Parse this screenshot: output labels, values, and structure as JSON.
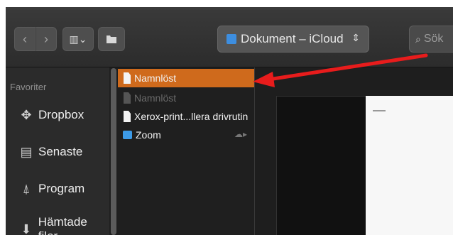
{
  "toolbar": {
    "back_icon": "chevron-left-icon",
    "forward_icon": "chevron-right-icon",
    "view_icon": "columns-view-icon",
    "view_menu_glyph": "⌄",
    "folder_icon": "folder-action-icon",
    "path_label": "Dokument – iCloud",
    "search_placeholder": "Sök"
  },
  "sidebar": {
    "header": "Favoriter",
    "items": [
      {
        "label": "Dropbox",
        "icon": "dropbox-icon"
      },
      {
        "label": "Senaste",
        "icon": "recents-icon"
      },
      {
        "label": "Program",
        "icon": "applications-icon"
      },
      {
        "label": "Hämtade filer",
        "icon": "downloads-icon"
      }
    ]
  },
  "files": [
    {
      "name": "Namnlöst",
      "selected": true
    },
    {
      "name": "Namnlöst",
      "dimmed": true
    },
    {
      "name": "Xerox-print...llera drivrutin"
    },
    {
      "name": "Zoom",
      "type": "folder"
    }
  ],
  "annotation": {
    "arrow_color": "#e81c1c"
  },
  "colors": {
    "selection": "#cf6a1c",
    "folder": "#3d9be8"
  }
}
